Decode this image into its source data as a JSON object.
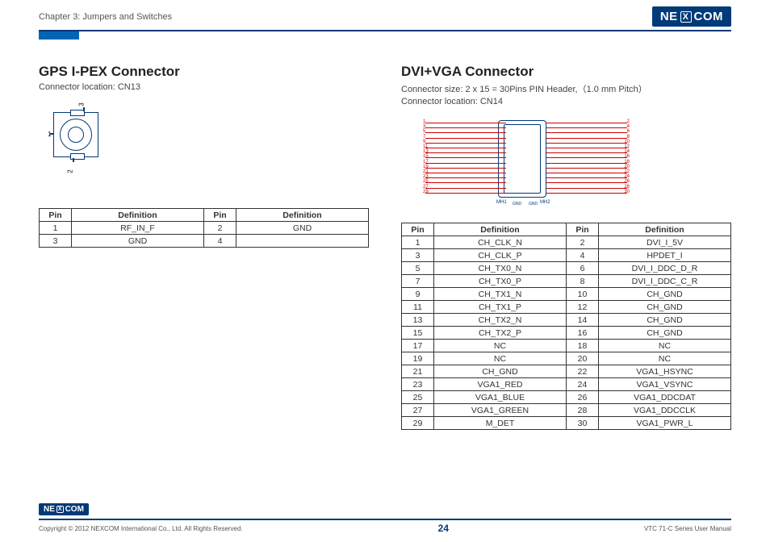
{
  "header": {
    "chapter": "Chapter 3: Jumpers and Switches",
    "logo_pre": "NE",
    "logo_x": "X",
    "logo_post": "COM"
  },
  "left": {
    "title": "GPS I-PEX Connector",
    "loc": "Connector location: CN13",
    "pinlabels": {
      "p1": "1",
      "p2": "2",
      "p3": "3"
    },
    "table": {
      "h_pin": "Pin",
      "h_def": "Definition",
      "rows": [
        {
          "pin": "1",
          "def": "RF_IN_F",
          "pin2": "2",
          "def2": "GND"
        },
        {
          "pin": "3",
          "def": "GND",
          "pin2": "4",
          "def2": ""
        }
      ]
    }
  },
  "right": {
    "title": "DVI+VGA  Connector",
    "size": "Connector size: 2 x 15 = 30Pins PIN Header,（1.0 mm Pitch）",
    "loc": "Connector location: CN14",
    "mh_l": "MH1",
    "mh_r": "MH2",
    "gnd": "GND",
    "pins_left": [
      "1",
      "3",
      "5",
      "7",
      "9",
      "11",
      "13",
      "15",
      "17",
      "19",
      "21",
      "23",
      "25",
      "27",
      "29"
    ],
    "pins_right": [
      "2",
      "4",
      "6",
      "8",
      "10",
      "12",
      "14",
      "16",
      "18",
      "20",
      "22",
      "24",
      "26",
      "28",
      "30"
    ],
    "table": {
      "h_pin": "Pin",
      "h_def": "Definition",
      "rows": [
        {
          "pin": "1",
          "def": "CH_CLK_N",
          "pin2": "2",
          "def2": "DVI_I_5V"
        },
        {
          "pin": "3",
          "def": "CH_CLK_P",
          "pin2": "4",
          "def2": "HPDET_I"
        },
        {
          "pin": "5",
          "def": "CH_TX0_N",
          "pin2": "6",
          "def2": "DVI_I_DDC_D_R"
        },
        {
          "pin": "7",
          "def": "CH_TX0_P",
          "pin2": "8",
          "def2": "DVI_I_DDC_C_R"
        },
        {
          "pin": "9",
          "def": "CH_TX1_N",
          "pin2": "10",
          "def2": "CH_GND"
        },
        {
          "pin": "11",
          "def": "CH_TX1_P",
          "pin2": "12",
          "def2": "CH_GND"
        },
        {
          "pin": "13",
          "def": "CH_TX2_N",
          "pin2": "14",
          "def2": "CH_GND"
        },
        {
          "pin": "15",
          "def": "CH_TX2_P",
          "pin2": "16",
          "def2": "CH_GND"
        },
        {
          "pin": "17",
          "def": "NC",
          "pin2": "18",
          "def2": "NC"
        },
        {
          "pin": "19",
          "def": "NC",
          "pin2": "20",
          "def2": "NC"
        },
        {
          "pin": "21",
          "def": "CH_GND",
          "pin2": "22",
          "def2": "VGA1_HSYNC"
        },
        {
          "pin": "23",
          "def": "VGA1_RED",
          "pin2": "24",
          "def2": "VGA1_VSYNC"
        },
        {
          "pin": "25",
          "def": "VGA1_BLUE",
          "pin2": "26",
          "def2": "VGA1_DDCDAT"
        },
        {
          "pin": "27",
          "def": "VGA1_GREEN",
          "pin2": "28",
          "def2": "VGA1_DDCCLK"
        },
        {
          "pin": "29",
          "def": "M_DET",
          "pin2": "30",
          "def2": "VGA1_PWR_L"
        }
      ]
    }
  },
  "footer": {
    "copyright": "Copyright © 2012 NEXCOM International Co., Ltd. All Rights Reserved.",
    "page": "24",
    "manual": "VTC 71-C Series User Manual",
    "logo_pre": "NE",
    "logo_x": "X",
    "logo_post": "COM"
  }
}
